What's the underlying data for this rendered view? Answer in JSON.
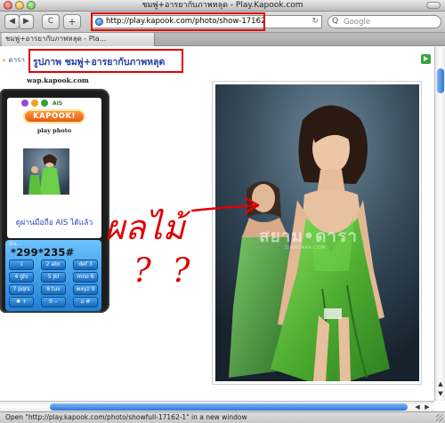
{
  "window": {
    "title": "ชมพู่+อารยากับภาพหลุด - Play.Kapook.com"
  },
  "toolbar": {
    "back_glyph": "◀",
    "forward_glyph": "▶",
    "reload_glyph": "C",
    "add_glyph": "+",
    "url": "http://play.kapook.com/photo/show-17162",
    "search_placeholder": "Google",
    "search_glyph": "Q",
    "url_refresh_glyph": "↻"
  },
  "tab": {
    "label": "ชมพู่+อารยากับภาพหลุด - Pla..."
  },
  "page": {
    "breadcrumb_dot": "»",
    "breadcrumb": "ดารา",
    "title": "รูปภาพ ชมพู่+อารยากับภาพหลุด",
    "wap_label": "wap.kapook.com"
  },
  "phone": {
    "status_text": "AIS",
    "logo": "KAPOOK!",
    "subtitle": "play photo",
    "caption": "ดูผ่านมือถือ AIS ได้แล้ว",
    "keypad_label": "Ins...",
    "code": "*299*235#",
    "keys": [
      [
        "1",
        "2 abc",
        "def 3"
      ],
      [
        "4 ghi",
        "5 jkl",
        "mno 6"
      ],
      [
        "7 pqrs",
        "8 tuv",
        "wxyz 9"
      ],
      [
        "✱ +",
        "0 ⌣",
        "⌂ #"
      ]
    ]
  },
  "photo": {
    "watermark": "สยาม•ดารา",
    "watermark_sub": "SIAMDARA.COM"
  },
  "annotation": {
    "word": "ผลไม้",
    "questions": "? ?"
  },
  "statusbar": {
    "text": "Open \"http://play.kapook.com/photo/showfull-17162-1\" in a new window"
  },
  "colors": {
    "highlight": "#e00000",
    "link": "#1f3fa8",
    "scroll_thumb": "#2f78d6",
    "photo_dress": "#5cbf3a"
  },
  "icons": {
    "globe": "globe-icon",
    "search": "search-icon",
    "refresh": "refresh-icon",
    "expand": "right-arrow-icon"
  }
}
